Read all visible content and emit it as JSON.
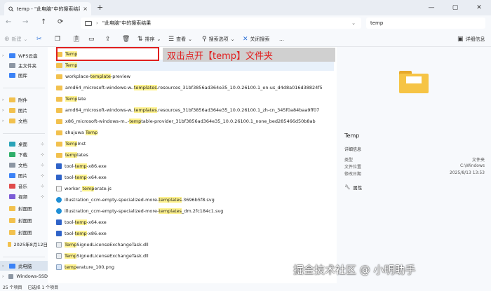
{
  "window": {
    "tab_title": "temp - \"此电脑\"中的搜索结果",
    "tab_close": "×",
    "new_tab": "+",
    "minimize": "—",
    "maximize": "▢",
    "close": "✕"
  },
  "address": {
    "crumb": "\"此电脑\"中的搜索结果",
    "search_value": "temp"
  },
  "toolbar": {
    "new_label": "新建",
    "sort_label": "排序",
    "view_label": "查看",
    "search_options_label": "搜索选项",
    "close_search_label": "关闭搜索",
    "more_label": "…",
    "details_label": "详细信息"
  },
  "sidebar": {
    "items": [
      {
        "label": "WPS云盘",
        "icon": "cloud-icon",
        "chevron": "›"
      },
      {
        "label": "主文件夹",
        "icon": "home-icon",
        "chevron": ""
      },
      {
        "label": "图库",
        "icon": "gallery-icon",
        "chevron": ""
      },
      {
        "label": "附件",
        "icon": "folder-icon",
        "chevron": "›"
      },
      {
        "label": "图片",
        "icon": "folder-icon",
        "chevron": "›"
      },
      {
        "label": "文档",
        "icon": "folder-icon",
        "chevron": "›"
      },
      {
        "label": "桌面",
        "icon": "desktop-icon",
        "chevron": ""
      },
      {
        "label": "下载",
        "icon": "download-icon",
        "chevron": ""
      },
      {
        "label": "文档",
        "icon": "documents-icon",
        "chevron": ""
      },
      {
        "label": "图片",
        "icon": "pictures-icon",
        "chevron": ""
      },
      {
        "label": "音乐",
        "icon": "music-icon",
        "chevron": ""
      },
      {
        "label": "视频",
        "icon": "video-icon",
        "chevron": ""
      },
      {
        "label": "封面图",
        "icon": "folder-icon",
        "chevron": ""
      },
      {
        "label": "封面图",
        "icon": "folder-icon",
        "chevron": ""
      },
      {
        "label": "封面图",
        "icon": "folder-icon",
        "chevron": ""
      },
      {
        "label": "2025年8月12日",
        "icon": "folder-icon",
        "chevron": ""
      },
      {
        "label": "此电脑",
        "icon": "computer-icon",
        "chevron": "›"
      },
      {
        "label": "Windows-SSD",
        "icon": "drive-icon",
        "chevron": "›"
      }
    ],
    "pin": "⊹"
  },
  "files": [
    {
      "pre": "",
      "hl": "Temp",
      "post": "",
      "type": "folder"
    },
    {
      "pre": "",
      "hl": "Temp",
      "post": "",
      "type": "folder"
    },
    {
      "pre": "workplace-",
      "hl": "template",
      "post": "-preview",
      "type": "folder"
    },
    {
      "pre": "amd64_microsoft-windows-w..",
      "hl": "templates",
      "post": ".resources_31bf3856ad364e35_10.0.26100.1_en-us_d4d8a016d38824f5",
      "type": "folder"
    },
    {
      "pre": "",
      "hl": "Temp",
      "post": "late",
      "type": "folder"
    },
    {
      "pre": "amd64_microsoft-windows-w..",
      "hl": "templates",
      "post": ".resources_31bf3856ad364e35_10.0.26100.1_zh-cn_345f0a84baa9ff07",
      "type": "folder"
    },
    {
      "pre": "x86_microsoft-windows-m..-",
      "hl": "temp",
      "post": "table-provider_31bf3856ad364e35_10.0.26100.1_none_bed285466d50b8ab",
      "type": "folder"
    },
    {
      "pre": "shujuwa ",
      "hl": "Temp",
      "post": "",
      "type": "folder"
    },
    {
      "pre": "",
      "hl": "Temp",
      "post": "Inst",
      "type": "folder"
    },
    {
      "pre": "",
      "hl": "temp",
      "post": "lates",
      "type": "folder"
    },
    {
      "pre": "tool-",
      "hl": "temp",
      "post": "-x86.exe",
      "type": "exe"
    },
    {
      "pre": "tool-",
      "hl": "temp",
      "post": "-x64.exe",
      "type": "exe"
    },
    {
      "pre": "worker_",
      "hl": "temp",
      "post": "erate.js",
      "type": "js"
    },
    {
      "pre": "illustration_ccm-empty-specialized-more-",
      "hl": "templates",
      "post": ".3696b5f8.svg",
      "type": "edge"
    },
    {
      "pre": "illustration_ccm-empty-specialized-more-",
      "hl": "templates",
      "post": "_dm.2fc184c1.svg",
      "type": "edge"
    },
    {
      "pre": "tool-",
      "hl": "temp",
      "post": "-x64.exe",
      "type": "exe"
    },
    {
      "pre": "tool-",
      "hl": "temp",
      "post": "-x86.exe",
      "type": "exe"
    },
    {
      "pre": "",
      "hl": "Temp",
      "post": "SignedLicenseExchangeTask.dll",
      "type": "dll"
    },
    {
      "pre": "",
      "hl": "Temp",
      "post": "SignedLicenseExchangeTask.dll",
      "type": "dll"
    },
    {
      "pre": "",
      "hl": "temp",
      "post": "erature_100.png",
      "type": "png"
    }
  ],
  "annotation": "双击点开【temp】文件夹",
  "details": {
    "title": "Temp",
    "section": "详细信息",
    "rows": [
      {
        "label": "类型",
        "value": "文件夹"
      },
      {
        "label": "文件位置",
        "value": "C:\\Windows"
      },
      {
        "label": "修改日期",
        "value": "2025/8/13 13:53"
      }
    ],
    "properties_label": "属性"
  },
  "status": {
    "count": "25 个项目",
    "selected": "已选择 1 个项目"
  },
  "watermark": "掘金技术社区 @ 小明助手",
  "colors": {
    "accent": "#2a6fd6",
    "highlight": "#fff38f",
    "annotation": "#e02020"
  }
}
